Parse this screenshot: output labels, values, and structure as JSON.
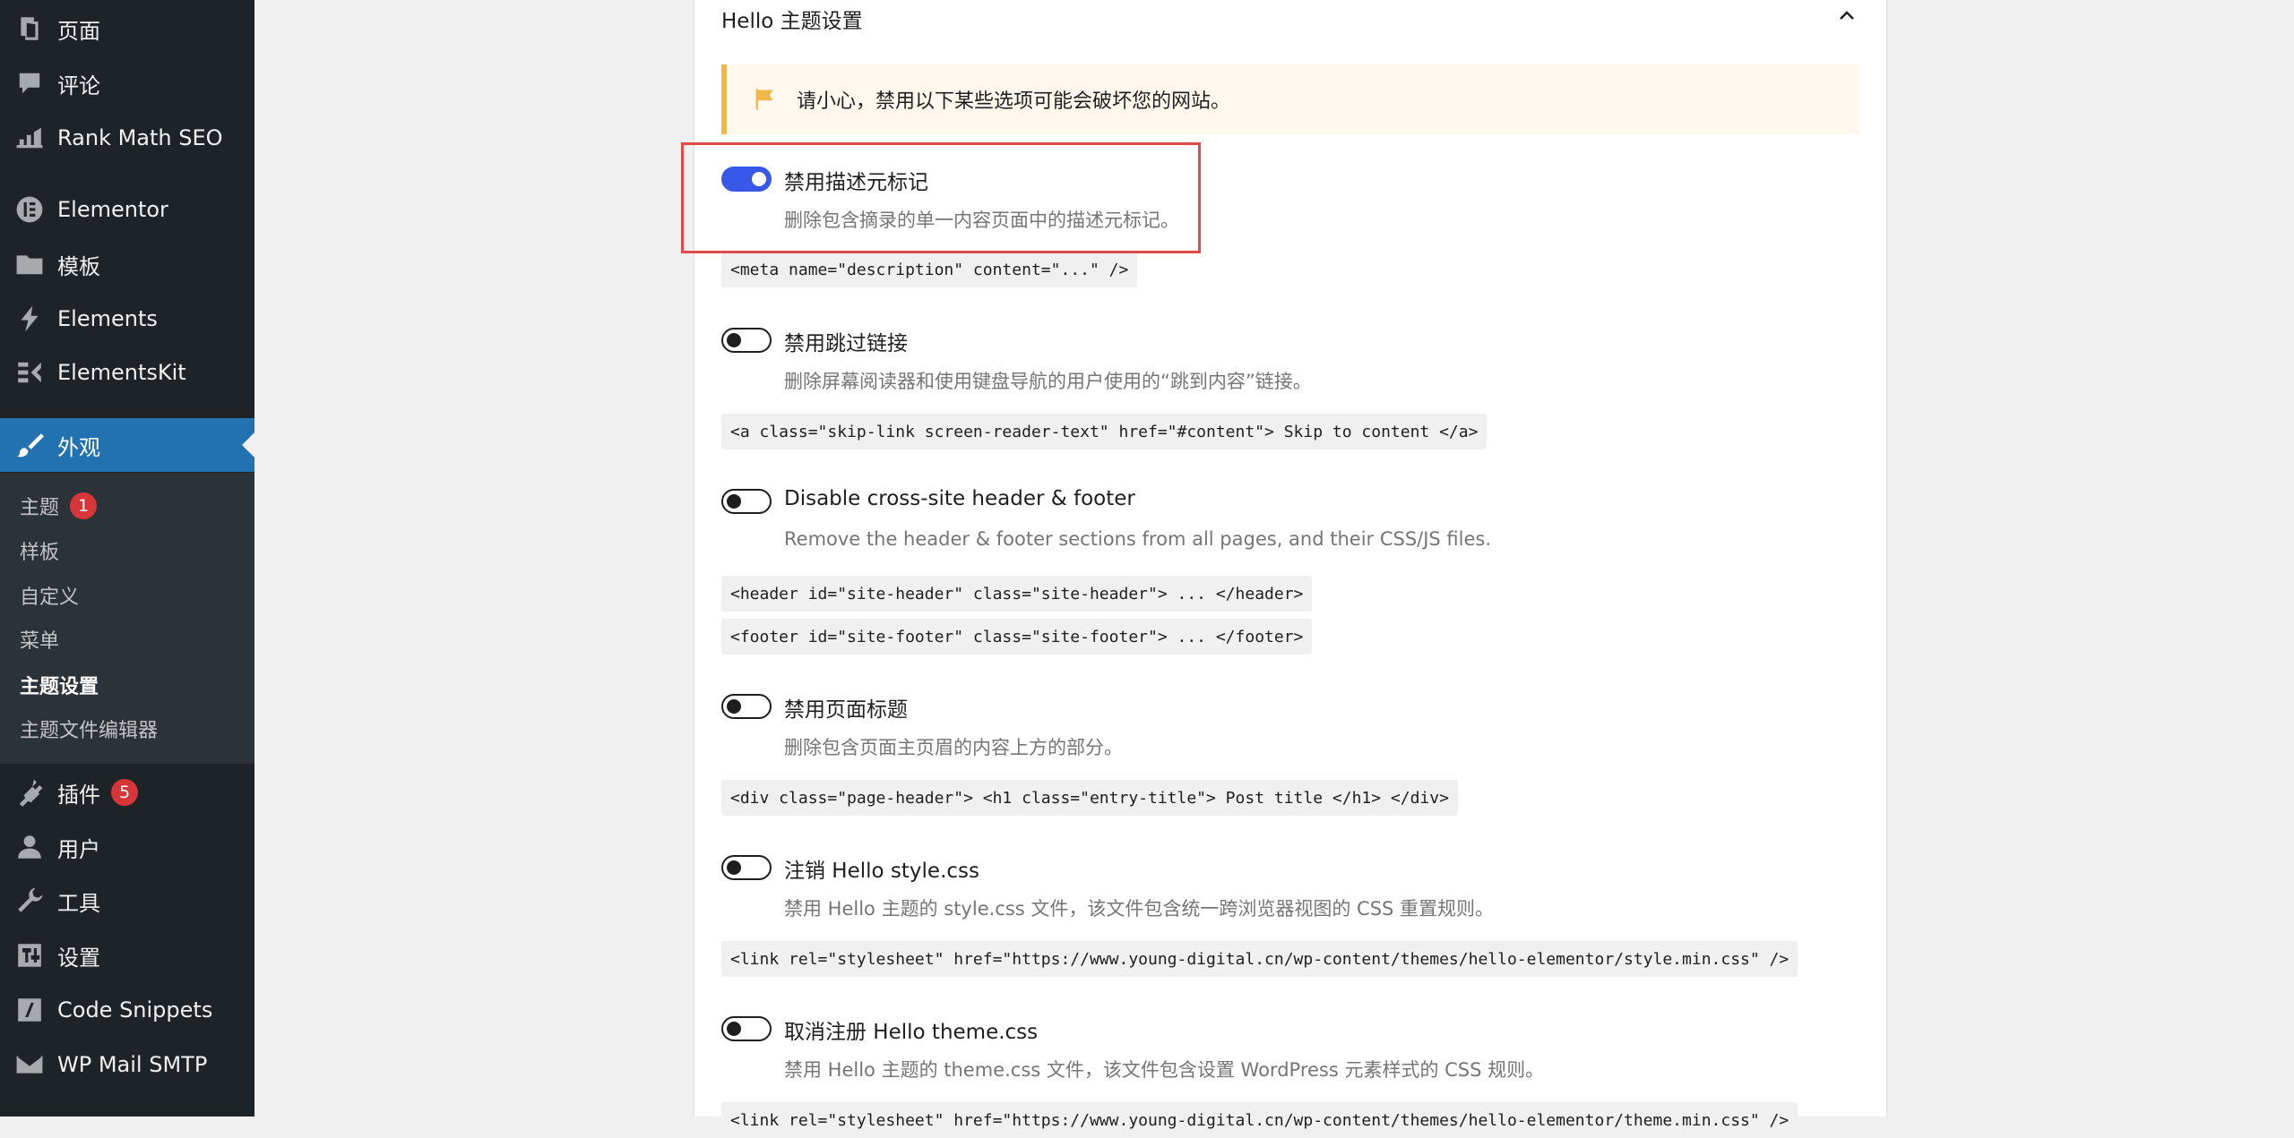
{
  "sidebar": {
    "items": [
      {
        "label": "页面",
        "icon": "pages-icon"
      },
      {
        "label": "评论",
        "icon": "comments-icon"
      },
      {
        "label": "Rank Math SEO",
        "icon": "rank-math-icon"
      },
      {
        "label": "Elementor",
        "icon": "elementor-icon"
      },
      {
        "label": "模板",
        "icon": "folder-icon"
      },
      {
        "label": "Elements",
        "icon": "elements-icon"
      },
      {
        "label": "ElementsKit",
        "icon": "elementskit-icon"
      },
      {
        "label": "外观",
        "icon": "paintbrush-icon"
      },
      {
        "label": "插件",
        "icon": "plugin-icon",
        "badge": "5"
      },
      {
        "label": "用户",
        "icon": "user-icon"
      },
      {
        "label": "工具",
        "icon": "wrench-icon"
      },
      {
        "label": "设置",
        "icon": "settings-icon"
      },
      {
        "label": "Code Snippets",
        "icon": "code-icon"
      },
      {
        "label": "WP Mail SMTP",
        "icon": "mail-icon"
      }
    ],
    "submenu": [
      {
        "label": "主题",
        "badge": "1"
      },
      {
        "label": "样板"
      },
      {
        "label": "自定义"
      },
      {
        "label": "菜单"
      },
      {
        "label": "主题设置"
      },
      {
        "label": "主题文件编辑器"
      }
    ]
  },
  "panel": {
    "title": "Hello 主题设置",
    "notice": "请小心，禁用以下某些选项可能会破坏您的网站。",
    "options": [
      {
        "label": "禁用描述元标记",
        "desc": "删除包含摘录的单一内容页面中的描述元标记。",
        "on": true,
        "code": [
          "<meta name=\"description\" content=\"...\" />"
        ]
      },
      {
        "label": "禁用跳过链接",
        "desc": "删除屏幕阅读器和使用键盘导航的用户使用的“跳到内容”链接。",
        "on": false,
        "code": [
          "<a class=\"skip-link screen-reader-text\" href=\"#content\"> Skip to content </a>"
        ]
      },
      {
        "label": "Disable cross-site header & footer",
        "desc": "Remove the header & footer sections from all pages, and their CSS/JS files.",
        "on": false,
        "code": [
          "<header id=\"site-header\" class=\"site-header\"> ... </header>",
          "<footer id=\"site-footer\" class=\"site-footer\"> ... </footer>"
        ]
      },
      {
        "label": "禁用页面标题",
        "desc": "删除包含页面主页眉的内容上方的部分。",
        "on": false,
        "code": [
          "<div class=\"page-header\"> <h1 class=\"entry-title\"> Post title </h1> </div>"
        ]
      },
      {
        "label": "注销 Hello style.css",
        "desc": "禁用 Hello 主题的 style.css 文件，该文件包含统一跨浏览器视图的 CSS 重置规则。",
        "on": false,
        "code": [
          "<link rel=\"stylesheet\" href=\"https://www.young-digital.cn/wp-content/themes/hello-elementor/style.min.css\" />"
        ]
      },
      {
        "label": "取消注册 Hello theme.css",
        "desc": "禁用 Hello 主题的 theme.css 文件，该文件包含设置 WordPress 元素样式的 CSS 规则。",
        "on": false,
        "code": [
          "<link rel=\"stylesheet\" href=\"https://www.young-digital.cn/wp-content/themes/hello-elementor/theme.min.css\" />"
        ]
      }
    ]
  },
  "colors": {
    "sidebar_bg": "#1d2327",
    "active": "#2271b1",
    "toggle_on": "#3858e9",
    "badge": "#d63638",
    "notice_border": "#f0b849",
    "highlight": "#e04a4a"
  }
}
